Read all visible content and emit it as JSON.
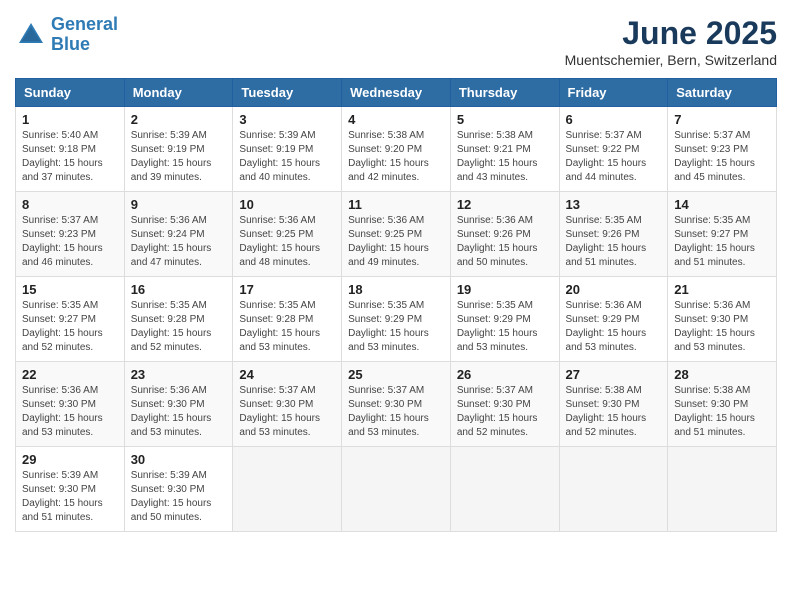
{
  "logo": {
    "line1": "General",
    "line2": "Blue"
  },
  "title": "June 2025",
  "location": "Muentschemier, Bern, Switzerland",
  "weekdays": [
    "Sunday",
    "Monday",
    "Tuesday",
    "Wednesday",
    "Thursday",
    "Friday",
    "Saturday"
  ],
  "weeks": [
    [
      {
        "day": "1",
        "info": "Sunrise: 5:40 AM\nSunset: 9:18 PM\nDaylight: 15 hours\nand 37 minutes."
      },
      {
        "day": "2",
        "info": "Sunrise: 5:39 AM\nSunset: 9:19 PM\nDaylight: 15 hours\nand 39 minutes."
      },
      {
        "day": "3",
        "info": "Sunrise: 5:39 AM\nSunset: 9:19 PM\nDaylight: 15 hours\nand 40 minutes."
      },
      {
        "day": "4",
        "info": "Sunrise: 5:38 AM\nSunset: 9:20 PM\nDaylight: 15 hours\nand 42 minutes."
      },
      {
        "day": "5",
        "info": "Sunrise: 5:38 AM\nSunset: 9:21 PM\nDaylight: 15 hours\nand 43 minutes."
      },
      {
        "day": "6",
        "info": "Sunrise: 5:37 AM\nSunset: 9:22 PM\nDaylight: 15 hours\nand 44 minutes."
      },
      {
        "day": "7",
        "info": "Sunrise: 5:37 AM\nSunset: 9:23 PM\nDaylight: 15 hours\nand 45 minutes."
      }
    ],
    [
      {
        "day": "8",
        "info": "Sunrise: 5:37 AM\nSunset: 9:23 PM\nDaylight: 15 hours\nand 46 minutes."
      },
      {
        "day": "9",
        "info": "Sunrise: 5:36 AM\nSunset: 9:24 PM\nDaylight: 15 hours\nand 47 minutes."
      },
      {
        "day": "10",
        "info": "Sunrise: 5:36 AM\nSunset: 9:25 PM\nDaylight: 15 hours\nand 48 minutes."
      },
      {
        "day": "11",
        "info": "Sunrise: 5:36 AM\nSunset: 9:25 PM\nDaylight: 15 hours\nand 49 minutes."
      },
      {
        "day": "12",
        "info": "Sunrise: 5:36 AM\nSunset: 9:26 PM\nDaylight: 15 hours\nand 50 minutes."
      },
      {
        "day": "13",
        "info": "Sunrise: 5:35 AM\nSunset: 9:26 PM\nDaylight: 15 hours\nand 51 minutes."
      },
      {
        "day": "14",
        "info": "Sunrise: 5:35 AM\nSunset: 9:27 PM\nDaylight: 15 hours\nand 51 minutes."
      }
    ],
    [
      {
        "day": "15",
        "info": "Sunrise: 5:35 AM\nSunset: 9:27 PM\nDaylight: 15 hours\nand 52 minutes."
      },
      {
        "day": "16",
        "info": "Sunrise: 5:35 AM\nSunset: 9:28 PM\nDaylight: 15 hours\nand 52 minutes."
      },
      {
        "day": "17",
        "info": "Sunrise: 5:35 AM\nSunset: 9:28 PM\nDaylight: 15 hours\nand 53 minutes."
      },
      {
        "day": "18",
        "info": "Sunrise: 5:35 AM\nSunset: 9:29 PM\nDaylight: 15 hours\nand 53 minutes."
      },
      {
        "day": "19",
        "info": "Sunrise: 5:35 AM\nSunset: 9:29 PM\nDaylight: 15 hours\nand 53 minutes."
      },
      {
        "day": "20",
        "info": "Sunrise: 5:36 AM\nSunset: 9:29 PM\nDaylight: 15 hours\nand 53 minutes."
      },
      {
        "day": "21",
        "info": "Sunrise: 5:36 AM\nSunset: 9:30 PM\nDaylight: 15 hours\nand 53 minutes."
      }
    ],
    [
      {
        "day": "22",
        "info": "Sunrise: 5:36 AM\nSunset: 9:30 PM\nDaylight: 15 hours\nand 53 minutes."
      },
      {
        "day": "23",
        "info": "Sunrise: 5:36 AM\nSunset: 9:30 PM\nDaylight: 15 hours\nand 53 minutes."
      },
      {
        "day": "24",
        "info": "Sunrise: 5:37 AM\nSunset: 9:30 PM\nDaylight: 15 hours\nand 53 minutes."
      },
      {
        "day": "25",
        "info": "Sunrise: 5:37 AM\nSunset: 9:30 PM\nDaylight: 15 hours\nand 53 minutes."
      },
      {
        "day": "26",
        "info": "Sunrise: 5:37 AM\nSunset: 9:30 PM\nDaylight: 15 hours\nand 52 minutes."
      },
      {
        "day": "27",
        "info": "Sunrise: 5:38 AM\nSunset: 9:30 PM\nDaylight: 15 hours\nand 52 minutes."
      },
      {
        "day": "28",
        "info": "Sunrise: 5:38 AM\nSunset: 9:30 PM\nDaylight: 15 hours\nand 51 minutes."
      }
    ],
    [
      {
        "day": "29",
        "info": "Sunrise: 5:39 AM\nSunset: 9:30 PM\nDaylight: 15 hours\nand 51 minutes."
      },
      {
        "day": "30",
        "info": "Sunrise: 5:39 AM\nSunset: 9:30 PM\nDaylight: 15 hours\nand 50 minutes."
      },
      {
        "day": "",
        "info": ""
      },
      {
        "day": "",
        "info": ""
      },
      {
        "day": "",
        "info": ""
      },
      {
        "day": "",
        "info": ""
      },
      {
        "day": "",
        "info": ""
      }
    ]
  ]
}
